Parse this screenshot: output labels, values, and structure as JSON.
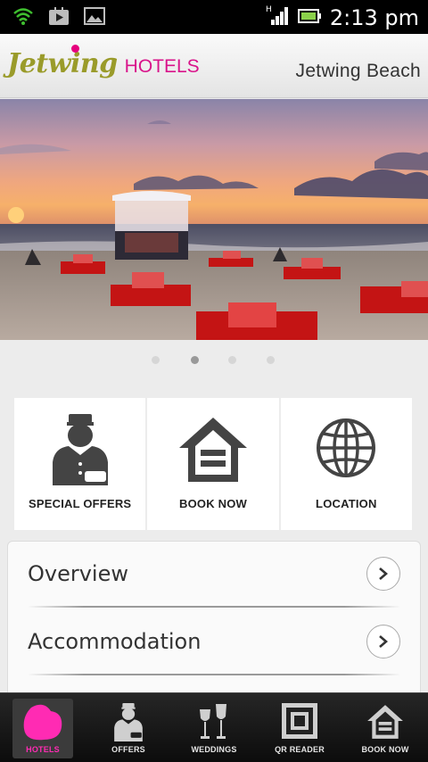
{
  "status_bar": {
    "time": "2:13 pm",
    "icons": [
      "wifi-icon",
      "play-store-icon",
      "gallery-icon",
      "signal-icon",
      "battery-icon"
    ]
  },
  "header": {
    "logo_brand": "Jetwing",
    "logo_suffix": "HOTELS",
    "hotel_name": "Jetwing Beach"
  },
  "carousel": {
    "page_count": 4,
    "active_index": 1
  },
  "tiles": [
    {
      "label": "SPECIAL OFFERS",
      "icon": "concierge-icon"
    },
    {
      "label": "BOOK NOW",
      "icon": "house-icon"
    },
    {
      "label": "LOCATION",
      "icon": "globe-icon"
    }
  ],
  "menu": [
    {
      "label": "Overview"
    },
    {
      "label": "Accommodation"
    }
  ],
  "tabbar": [
    {
      "label": "HOTELS",
      "icon": "hotels-icon",
      "active": true
    },
    {
      "label": "OFFERS",
      "icon": "concierge-icon",
      "active": false
    },
    {
      "label": "WEDDINGS",
      "icon": "wine-glasses-icon",
      "active": false
    },
    {
      "label": "QR READER",
      "icon": "qr-code-icon",
      "active": false
    },
    {
      "label": "BOOK NOW",
      "icon": "house-icon",
      "active": false
    }
  ],
  "colors": {
    "brand_olive": "#9a9b2a",
    "brand_magenta": "#d9138a",
    "tab_active": "#ff2bb3"
  }
}
